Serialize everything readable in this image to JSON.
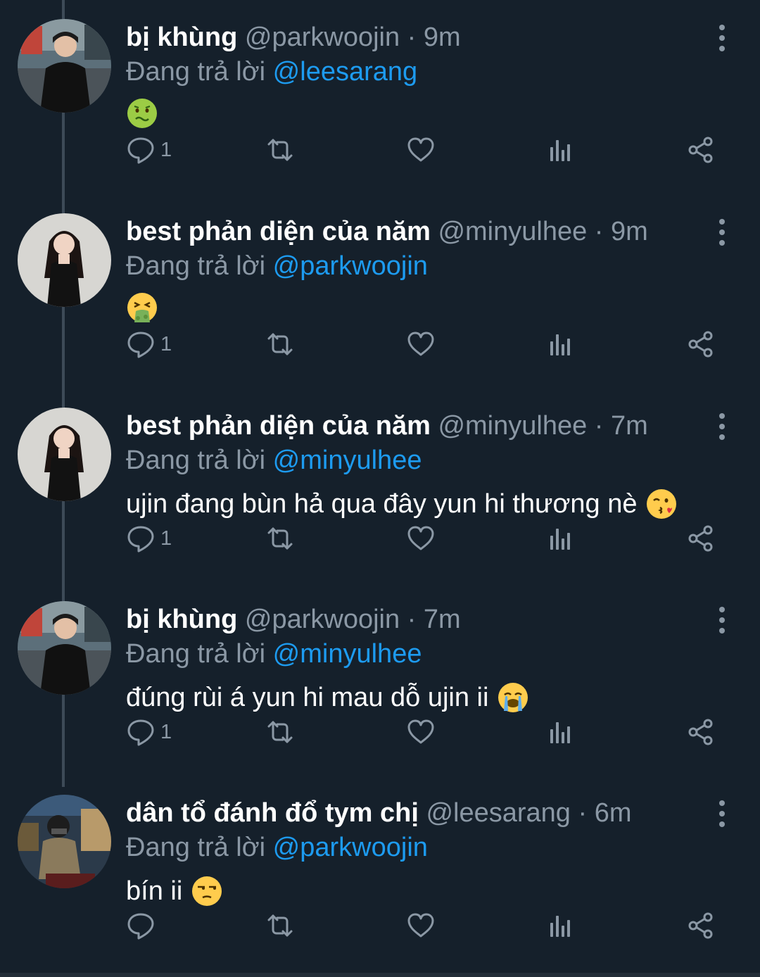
{
  "replying_prefix": "Đang trả lời",
  "colors": {
    "background": "#15202b",
    "muted": "#8b98a5",
    "mention": "#1d9bf0",
    "thread_line": "#3d4a57"
  },
  "tweets": [
    {
      "name": "bị khùng",
      "handle": "@parkwoojin",
      "separator": "·",
      "time": "9m",
      "reply_to": "@leesarang",
      "text": "",
      "emoji": "nauseated-face",
      "reply_count": "1",
      "avatar": "man-black-shirt"
    },
    {
      "name": "best phản diện của năm",
      "handle": "@minyulhee",
      "separator": "·",
      "time": "9m",
      "reply_to": "@parkwoojin",
      "text": "",
      "emoji": "vomiting-face",
      "reply_count": "1",
      "avatar": "woman-black-dress"
    },
    {
      "name": "best phản diện của năm",
      "handle": "@minyulhee",
      "separator": "·",
      "time": "7m",
      "reply_to": "@minyulhee",
      "text": "ujin đang bùn hả qua đây yun hi thương nè",
      "emoji": "kissing-face-heart",
      "reply_count": "1",
      "avatar": "woman-black-dress"
    },
    {
      "name": "bị khùng",
      "handle": "@parkwoojin",
      "separator": "·",
      "time": "7m",
      "reply_to": "@minyulhee",
      "text": "đúng rùi á yun hi mau dỗ ujin ii",
      "emoji": "crying-face",
      "reply_count": "1",
      "avatar": "man-black-shirt"
    },
    {
      "name": "dân tổ đánh đổ tym chị",
      "handle": "@leesarang",
      "separator": "·",
      "time": "6m",
      "reply_to": "@parkwoojin",
      "text": "bín ii",
      "emoji": "unamused-face",
      "reply_count": "",
      "avatar": "man-helmet-jacket"
    }
  ],
  "icons": [
    "reply-icon",
    "retweet-icon",
    "like-icon",
    "views-icon",
    "share-icon",
    "more-icon"
  ]
}
